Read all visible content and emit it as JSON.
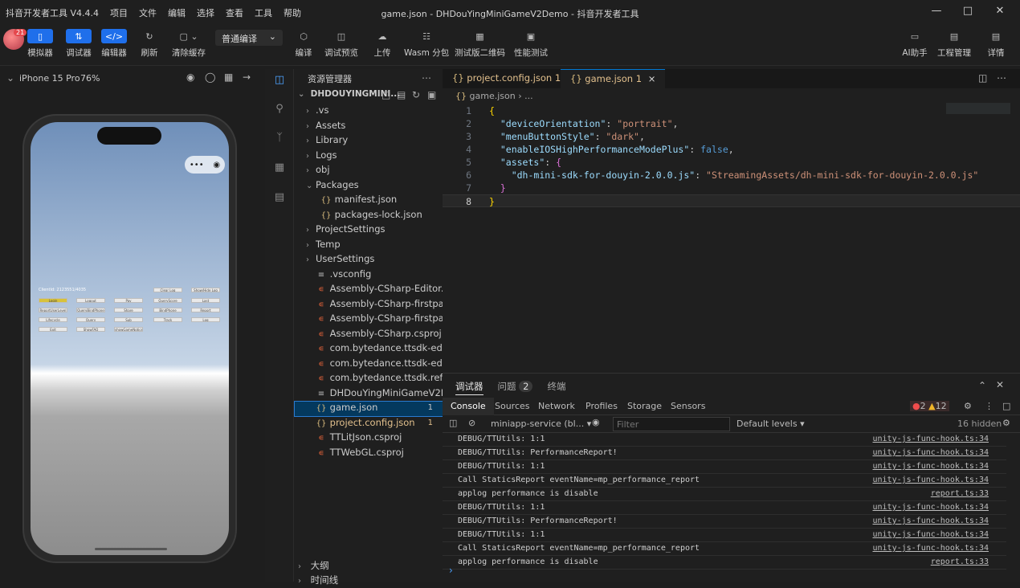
{
  "app": {
    "name_version": "抖音开发者工具 V4.4.4",
    "menu": [
      "项目",
      "文件",
      "编辑",
      "选择",
      "查看",
      "工具",
      "帮助"
    ],
    "window_title": "game.json - DHDouYingMiniGameV2Demo - 抖音开发者工具"
  },
  "toolbar": {
    "avatar_badge": "21",
    "left": [
      {
        "label": "模拟器",
        "icon": "phone-icon"
      },
      {
        "label": "调试器",
        "icon": "sliders-icon"
      },
      {
        "label": "编辑器",
        "icon": "code-icon"
      },
      {
        "label": "刷新",
        "icon": "refresh-icon"
      },
      {
        "label": "清除缓存",
        "icon": "clear-cache-icon"
      }
    ],
    "compile_mode": "普通编译",
    "middle": [
      {
        "label": "编译",
        "icon": "cube-icon"
      },
      {
        "label": "调试预览",
        "icon": "preview-icon"
      },
      {
        "label": "上传",
        "icon": "upload-icon"
      },
      {
        "label": "Wasm 分包",
        "icon": "wasm-icon"
      },
      {
        "label": "测试版二维码",
        "icon": "qrcode-icon"
      },
      {
        "label": "性能测试",
        "icon": "performance-icon"
      }
    ],
    "right": [
      {
        "label": "AI助手",
        "icon": "ai-icon"
      },
      {
        "label": "工程管理",
        "icon": "project-icon"
      },
      {
        "label": "详情",
        "icon": "details-icon"
      }
    ]
  },
  "simulator": {
    "device": "iPhone 15 Pro",
    "zoom": "76%",
    "game_buttons": [
      "Login",
      "Logout",
      "Pay",
      "QueryScore",
      "Last",
      "ReportUserLevel",
      "QueryBindPhone",
      "Share",
      "BindPhone",
      "Report",
      "Lifecycle",
      "Query",
      "Sub",
      "Track",
      "Log",
      "Exit",
      "ShowFAQ",
      "showGameNotice",
      "Clear Log",
      "Show/Hide Log"
    ],
    "header_text": "ClientId: 2123551/4035"
  },
  "explorer": {
    "title": "资源管理器",
    "root": "DHDOUYINGMINI...",
    "items": [
      {
        "label": ".vs",
        "type": "folder"
      },
      {
        "label": "Assets",
        "type": "folder"
      },
      {
        "label": "Library",
        "type": "folder"
      },
      {
        "label": "Logs",
        "type": "folder"
      },
      {
        "label": "obj",
        "type": "folder"
      },
      {
        "label": "Packages",
        "type": "folder-open"
      },
      {
        "label": "manifest.json",
        "type": "json",
        "indent": 1
      },
      {
        "label": "packages-lock.json",
        "type": "json",
        "indent": 1
      },
      {
        "label": "ProjectSettings",
        "type": "folder"
      },
      {
        "label": "Temp",
        "type": "folder"
      },
      {
        "label": "UserSettings",
        "type": "folder"
      },
      {
        "label": ".vsconfig",
        "type": "text"
      },
      {
        "label": "Assembly-CSharp-Editor.csproj",
        "type": "rss"
      },
      {
        "label": "Assembly-CSharp-firstpass.csp...",
        "type": "rss"
      },
      {
        "label": "Assembly-CSharp-firstpass.csp...",
        "type": "rss"
      },
      {
        "label": "Assembly-CSharp.csproj",
        "type": "rss"
      },
      {
        "label": "com.bytedance.ttsdk-editor.cs...",
        "type": "rss"
      },
      {
        "label": "com.bytedance.ttsdk-editor.cs...",
        "type": "rss"
      },
      {
        "label": "com.bytedance.ttsdk.ref.csproj",
        "type": "rss"
      },
      {
        "label": "DHDouYingMiniGameV2Demo....",
        "type": "text"
      },
      {
        "label": "game.json",
        "type": "json",
        "badge": "1",
        "selected": true
      },
      {
        "label": "project.config.json",
        "type": "json",
        "badge": "1",
        "warn": true
      },
      {
        "label": "TTLitJson.csproj",
        "type": "rss"
      },
      {
        "label": "TTWebGL.csproj",
        "type": "rss"
      }
    ],
    "outline": "大纲",
    "timeline": "时间线"
  },
  "editor": {
    "tabs": [
      {
        "label": "project.config.json",
        "badge": "1"
      },
      {
        "label": "game.json",
        "badge": "1",
        "close": "×"
      }
    ],
    "breadcrumb": [
      "game.json",
      "..."
    ],
    "lines": [
      {
        "n": "1"
      },
      {
        "n": "2"
      },
      {
        "n": "3"
      },
      {
        "n": "4"
      },
      {
        "n": "5"
      },
      {
        "n": "6"
      },
      {
        "n": "7"
      },
      {
        "n": "8"
      }
    ],
    "code": {
      "k1": "\"deviceOrientation\"",
      "v1": "\"portrait\"",
      "k2": "\"menuButtonStyle\"",
      "v2": "\"dark\"",
      "k3": "\"enableIOSHighPerformanceModePlus\"",
      "v3": "false",
      "k4": "\"assets\"",
      "k5": "\"dh-mini-sdk-for-douyin-2.0.0.js\"",
      "v5": "\"StreamingAssets/dh-mini-sdk-for-douyin-2.0.0.js\""
    }
  },
  "panel": {
    "tabs": [
      {
        "label": "调试器"
      },
      {
        "label": "问题",
        "badge": "2"
      },
      {
        "label": "终端"
      }
    ],
    "devtools_tabs": [
      "Console",
      "Sources",
      "Network",
      "Profiles",
      "Storage",
      "Sensors"
    ],
    "errors": "2",
    "warnings": "12",
    "context": "miniapp-service (bl...",
    "filter_placeholder": "Filter",
    "levels": "Default levels",
    "hidden": "16 hidden",
    "logs": [
      {
        "msg": "DEBUG/TTUtils: 1:1",
        "src": "unity-js-func-hook.ts:34"
      },
      {
        "msg": "DEBUG/TTUtils: PerformanceReport!",
        "src": "unity-js-func-hook.ts:34"
      },
      {
        "msg": "DEBUG/TTUtils: 1:1",
        "src": "unity-js-func-hook.ts:34"
      },
      {
        "msg": "Call StaticsReport eventName=mp_performance_report",
        "src": "unity-js-func-hook.ts:34"
      },
      {
        "msg": "applog performance is disable",
        "src": "report.ts:33"
      },
      {
        "msg": "DEBUG/TTUtils: 1:1",
        "src": "unity-js-func-hook.ts:34"
      },
      {
        "msg": "DEBUG/TTUtils: PerformanceReport!",
        "src": "unity-js-func-hook.ts:34"
      },
      {
        "msg": "DEBUG/TTUtils: 1:1",
        "src": "unity-js-func-hook.ts:34"
      },
      {
        "msg": "Call StaticsReport eventName=mp_performance_report",
        "src": "unity-js-func-hook.ts:34"
      },
      {
        "msg": "applog performance is disable",
        "src": "report.ts:33"
      }
    ],
    "prompt": "›"
  }
}
